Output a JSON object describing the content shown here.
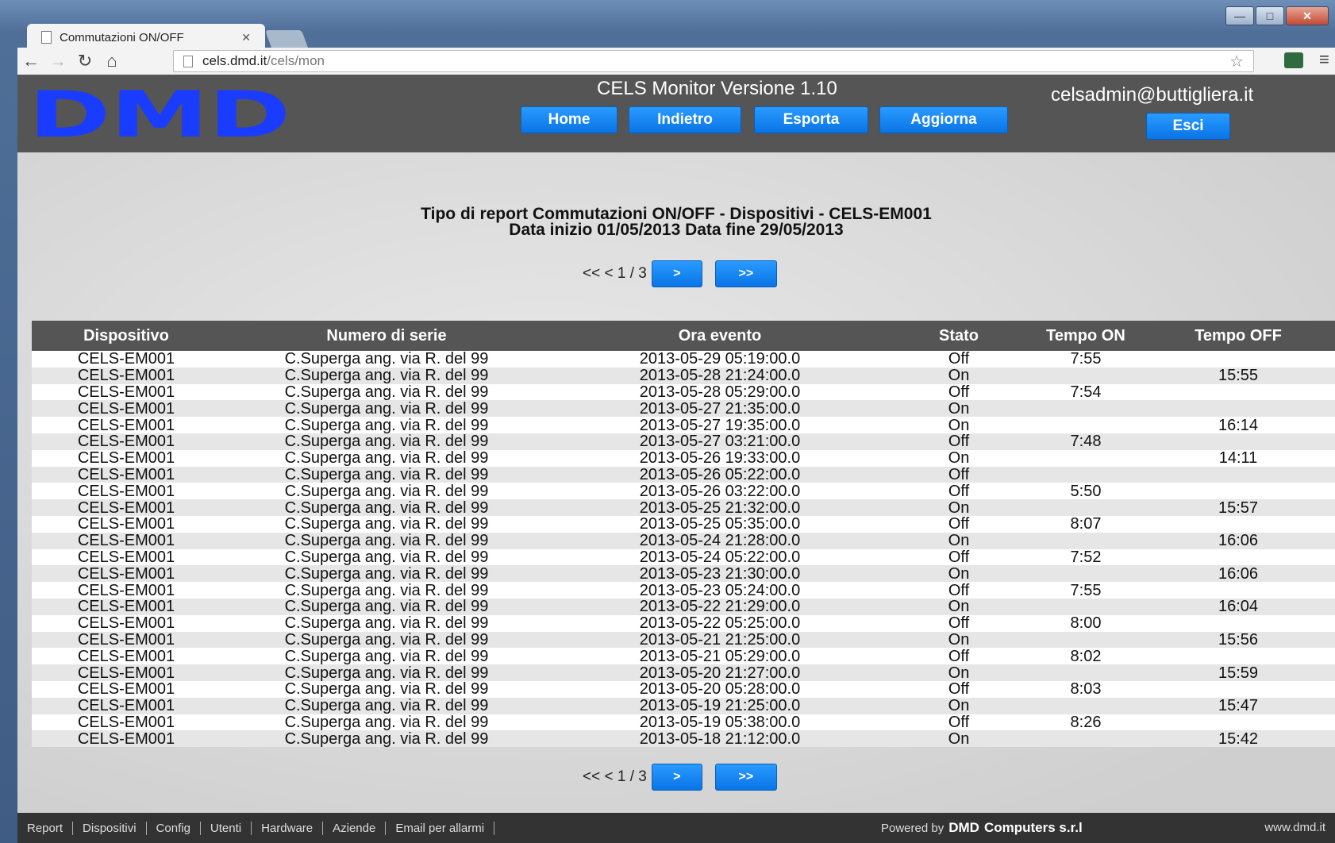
{
  "browser": {
    "tab_title": "Commutazioni ON/OFF",
    "url_host": "cels.dmd.it",
    "url_path": "/cels/mon"
  },
  "header": {
    "logo_text": "DMD",
    "app_title": "CELS Monitor Versione 1.10",
    "user": "celsadmin@buttigliera.it",
    "buttons": {
      "home": "Home",
      "back": "Indietro",
      "export": "Esporta",
      "refresh": "Aggiorna",
      "logout": "Esci"
    }
  },
  "report": {
    "title_line1": "Tipo di report Commutazioni ON/OFF - Dispositivi - CELS-EM001",
    "title_line2": "Data inizio 01/05/2013 Data fine 29/05/2013"
  },
  "pager": {
    "label": "<< < 1 / 3",
    "next": ">",
    "last": ">>"
  },
  "table": {
    "columns": [
      "Dispositivo",
      "Numero di serie",
      "Ora evento",
      "Stato",
      "Tempo ON",
      "Tempo OFF"
    ],
    "rows": [
      [
        "CELS-EM001",
        "C.Superga ang. via R. del 99",
        "2013-05-29 05:19:00.0",
        "Off",
        "7:55",
        ""
      ],
      [
        "CELS-EM001",
        "C.Superga ang. via R. del 99",
        "2013-05-28 21:24:00.0",
        "On",
        "",
        "15:55"
      ],
      [
        "CELS-EM001",
        "C.Superga ang. via R. del 99",
        "2013-05-28 05:29:00.0",
        "Off",
        "7:54",
        ""
      ],
      [
        "CELS-EM001",
        "C.Superga ang. via R. del 99",
        "2013-05-27 21:35:00.0",
        "On",
        "",
        ""
      ],
      [
        "CELS-EM001",
        "C.Superga ang. via R. del 99",
        "2013-05-27 19:35:00.0",
        "On",
        "",
        "16:14"
      ],
      [
        "CELS-EM001",
        "C.Superga ang. via R. del 99",
        "2013-05-27 03:21:00.0",
        "Off",
        "7:48",
        ""
      ],
      [
        "CELS-EM001",
        "C.Superga ang. via R. del 99",
        "2013-05-26 19:33:00.0",
        "On",
        "",
        "14:11"
      ],
      [
        "CELS-EM001",
        "C.Superga ang. via R. del 99",
        "2013-05-26 05:22:00.0",
        "Off",
        "",
        ""
      ],
      [
        "CELS-EM001",
        "C.Superga ang. via R. del 99",
        "2013-05-26 03:22:00.0",
        "Off",
        "5:50",
        ""
      ],
      [
        "CELS-EM001",
        "C.Superga ang. via R. del 99",
        "2013-05-25 21:32:00.0",
        "On",
        "",
        "15:57"
      ],
      [
        "CELS-EM001",
        "C.Superga ang. via R. del 99",
        "2013-05-25 05:35:00.0",
        "Off",
        "8:07",
        ""
      ],
      [
        "CELS-EM001",
        "C.Superga ang. via R. del 99",
        "2013-05-24 21:28:00.0",
        "On",
        "",
        "16:06"
      ],
      [
        "CELS-EM001",
        "C.Superga ang. via R. del 99",
        "2013-05-24 05:22:00.0",
        "Off",
        "7:52",
        ""
      ],
      [
        "CELS-EM001",
        "C.Superga ang. via R. del 99",
        "2013-05-23 21:30:00.0",
        "On",
        "",
        "16:06"
      ],
      [
        "CELS-EM001",
        "C.Superga ang. via R. del 99",
        "2013-05-23 05:24:00.0",
        "Off",
        "7:55",
        ""
      ],
      [
        "CELS-EM001",
        "C.Superga ang. via R. del 99",
        "2013-05-22 21:29:00.0",
        "On",
        "",
        "16:04"
      ],
      [
        "CELS-EM001",
        "C.Superga ang. via R. del 99",
        "2013-05-22 05:25:00.0",
        "Off",
        "8:00",
        ""
      ],
      [
        "CELS-EM001",
        "C.Superga ang. via R. del 99",
        "2013-05-21 21:25:00.0",
        "On",
        "",
        "15:56"
      ],
      [
        "CELS-EM001",
        "C.Superga ang. via R. del 99",
        "2013-05-21 05:29:00.0",
        "Off",
        "8:02",
        ""
      ],
      [
        "CELS-EM001",
        "C.Superga ang. via R. del 99",
        "2013-05-20 21:27:00.0",
        "On",
        "",
        "15:59"
      ],
      [
        "CELS-EM001",
        "C.Superga ang. via R. del 99",
        "2013-05-20 05:28:00.0",
        "Off",
        "8:03",
        ""
      ],
      [
        "CELS-EM001",
        "C.Superga ang. via R. del 99",
        "2013-05-19 21:25:00.0",
        "On",
        "",
        "15:47"
      ],
      [
        "CELS-EM001",
        "C.Superga ang. via R. del 99",
        "2013-05-19 05:38:00.0",
        "Off",
        "8:26",
        ""
      ],
      [
        "CELS-EM001",
        "C.Superga ang. via R. del 99",
        "2013-05-18 21:12:00.0",
        "On",
        "",
        "15:42"
      ]
    ]
  },
  "footer": {
    "links": [
      "Report",
      "Dispositivi",
      "Config",
      "Utenti",
      "Hardware",
      "Aziende",
      "Email per allarmi"
    ],
    "powered_by": "Powered by",
    "company": "Computers s.r.l",
    "site": "www.dmd.it"
  },
  "colors": {
    "button_blue": "#0a74e6",
    "header_gray": "#555555",
    "logo_blue": "#1a3cff"
  }
}
